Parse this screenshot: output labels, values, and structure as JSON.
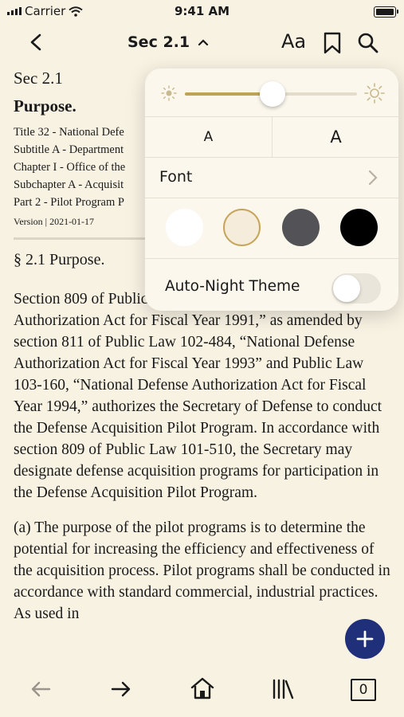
{
  "status_bar": {
    "carrier": "Carrier",
    "time": "9:41 AM"
  },
  "nav": {
    "title": "Sec 2.1",
    "text_settings": "Aa"
  },
  "doc": {
    "sec_label": "Sec 2.1",
    "heading": "Purpose.",
    "breadcrumbs": [
      "Title 32 - National Defe",
      "Subtitle A - Department",
      "Chapter I - Office of the",
      "Subchapter A - Acquisit",
      "Part 2 - Pilot Program P"
    ],
    "version": "Version | 2021-01-17",
    "section_heading": "§ 2.1 Purpose.",
    "paragraphs": [
      "Section 809 of Public Law 101-510, “National Defense Authorization Act for Fiscal Year 1991,” as amended by section 811 of Public Law 102-484, “National Defense Authorization Act for Fiscal Year 1993” and Public Law 103-160, “National Defense Authorization Act for Fiscal Year 1994,” authorizes the Secretary of Defense to conduct the Defense Acquisition Pilot Program. In accordance with section 809 of Public Law 101-510, the Secretary may designate defense acquisition programs for participation in the Defense Acquisition Pilot Program.",
      "(a) The purpose of the pilot programs is to determine the potential for increasing the efficiency and effectiveness of the acquisition process. Pilot programs shall be conducted in accordance with standard commercial, industrial practices. As used in"
    ]
  },
  "settings": {
    "brightness": 0.5,
    "smaller_text": "A",
    "larger_text": "A",
    "font_label": "Font",
    "themes": [
      "white",
      "sepia",
      "gray",
      "black"
    ],
    "selected_theme": "sepia",
    "auto_night_label": "Auto-Night Theme",
    "auto_night_on": false
  },
  "toolbar": {
    "tab_count": "0"
  },
  "colors": {
    "background": "#f8f2e3",
    "accent": "#bfa256",
    "fab": "#1f2f7a"
  }
}
